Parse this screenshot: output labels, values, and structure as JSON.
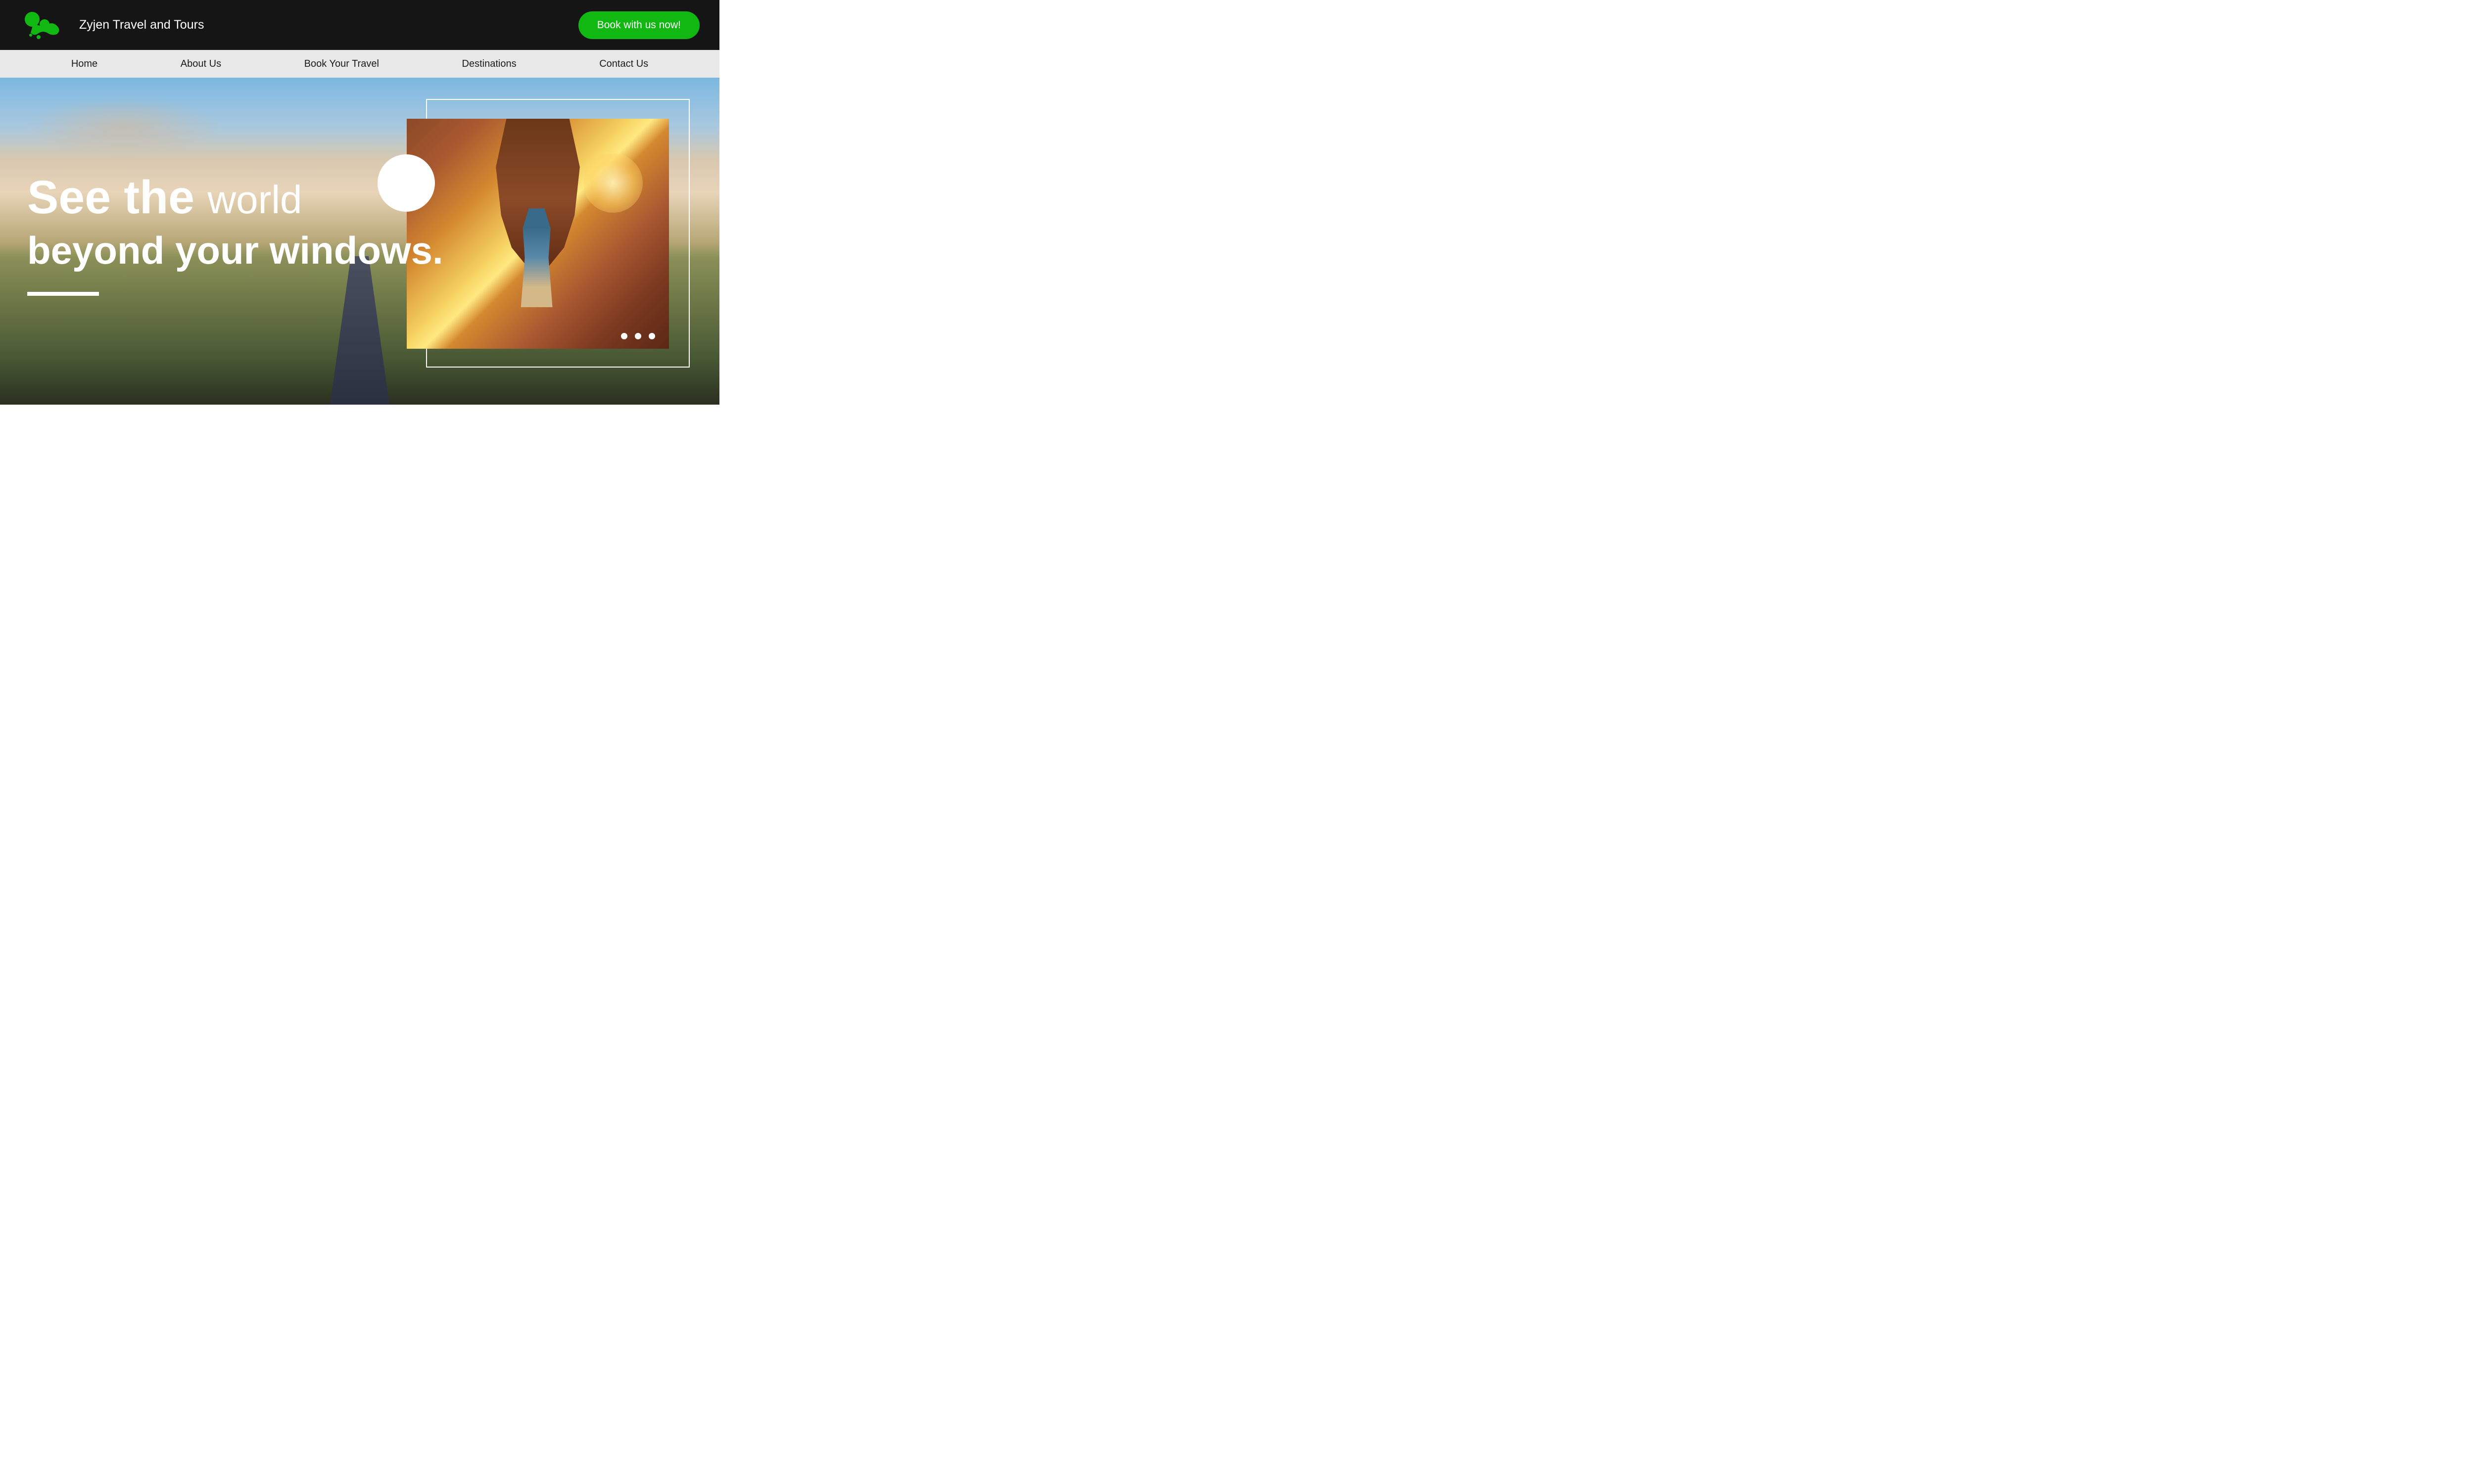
{
  "header": {
    "brand_name": "Zyjen Travel and Tours",
    "book_button": "Book with us now!",
    "logo_color": "#11b811"
  },
  "nav": {
    "items": [
      "Home",
      "About Us",
      "Book Your Travel",
      "Destinations",
      "Contact Us"
    ]
  },
  "hero": {
    "line1_bold": "See the",
    "line1_light": "world",
    "line2": "beyond your windows."
  },
  "colors": {
    "accent": "#11b811",
    "header_bg": "#151515",
    "nav_bg": "#e8e8e8"
  }
}
